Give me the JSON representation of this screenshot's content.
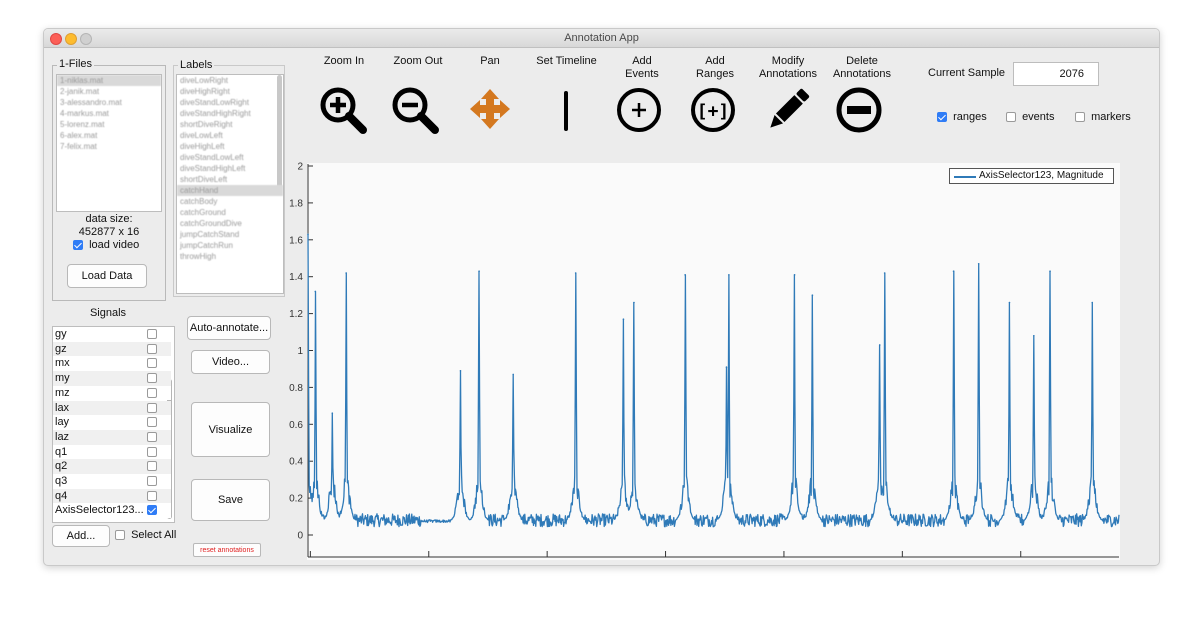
{
  "window": {
    "title": "Annotation App"
  },
  "files": {
    "title": "1-Files",
    "items": [
      "1-niklas.mat",
      "2-janik.mat",
      "3-alessandro.mat",
      "4-markus.mat",
      "5-lorenz.mat",
      "6-alex.mat",
      "7-felix.mat"
    ],
    "selected_index": 0,
    "data_size_label": "data size:",
    "data_size_value": "452877 x 16",
    "load_video_label": "load video",
    "load_video_checked": true,
    "load_button": "Load Data"
  },
  "labels": {
    "title": "Labels",
    "items": [
      "diveLowRight",
      "diveHighRight",
      "diveStandLowRight",
      "diveStandHighRight",
      "shortDiveRight",
      "diveLowLeft",
      "diveHighLeft",
      "diveStandLowLeft",
      "diveStandHighLeft",
      "shortDiveLeft",
      "catchHand",
      "catchBody",
      "catchGround",
      "catchGroundDive",
      "jumpCatchStand",
      "jumpCatchRun",
      "throwHigh"
    ],
    "selected_index": 10
  },
  "signals": {
    "title": "Signals",
    "items": [
      {
        "label": "gy",
        "checked": false
      },
      {
        "label": "gz",
        "checked": false
      },
      {
        "label": "mx",
        "checked": false
      },
      {
        "label": "my",
        "checked": false
      },
      {
        "label": "mz",
        "checked": false
      },
      {
        "label": "lax",
        "checked": false
      },
      {
        "label": "lay",
        "checked": false
      },
      {
        "label": "laz",
        "checked": false
      },
      {
        "label": "q1",
        "checked": false
      },
      {
        "label": "q2",
        "checked": false
      },
      {
        "label": "q3",
        "checked": false
      },
      {
        "label": "q4",
        "checked": false
      },
      {
        "label": "AxisSelector123...",
        "checked": true
      }
    ],
    "add_button": "Add...",
    "select_all_label": "Select All",
    "select_all_checked": false
  },
  "actions": {
    "auto_annotate": "Auto-annotate...",
    "video": "Video...",
    "visualize": "Visualize",
    "save": "Save",
    "reset": "reset annotations"
  },
  "toolbar": {
    "zoom_in": "Zoom In",
    "zoom_out": "Zoom Out",
    "pan": "Pan",
    "set_timeline": "Set Timeline",
    "add_events": "Add\nEvents",
    "add_ranges": "Add\nRanges",
    "modify": "Modify\nAnnotations",
    "delete": "Delete\nAnnotations"
  },
  "sample": {
    "label": "Current Sample",
    "value": "2076"
  },
  "visibility": {
    "ranges": {
      "label": "ranges",
      "checked": true
    },
    "events": {
      "label": "events",
      "checked": false
    },
    "markers": {
      "label": "markers",
      "checked": false
    }
  },
  "colors": {
    "line": "#2f7ab8",
    "pan_icon": "#d4781f",
    "checkbox": "#2f7cf6",
    "reset_text": "#e02020"
  },
  "chart_data": {
    "type": "line",
    "legend": [
      "AxisSelector123, Magnitude"
    ],
    "legend_position": "top-right",
    "ylim": [
      0,
      2
    ],
    "yticks": [
      0,
      0.2,
      0.4,
      0.6,
      0.8,
      1,
      1.2,
      1.4,
      1.6,
      1.8,
      2
    ],
    "ytick_labels": [
      "0",
      "0.2",
      "0.4",
      "0.6",
      "0.8",
      "1",
      "1.2",
      "1.4",
      "1.6",
      "1.8",
      "2"
    ],
    "x_tick_count": 7,
    "baseline": 0.08,
    "peaks": [
      {
        "x": 0.0,
        "y": 1.63
      },
      {
        "x": 0.009,
        "y": 1.32
      },
      {
        "x": 0.03,
        "y": 0.66
      },
      {
        "x": 0.047,
        "y": 1.42
      },
      {
        "x": 0.188,
        "y": 0.89
      },
      {
        "x": 0.211,
        "y": 1.43
      },
      {
        "x": 0.253,
        "y": 0.87
      },
      {
        "x": 0.33,
        "y": 1.42
      },
      {
        "x": 0.389,
        "y": 1.17
      },
      {
        "x": 0.402,
        "y": 1.26
      },
      {
        "x": 0.465,
        "y": 1.41
      },
      {
        "x": 0.516,
        "y": 0.91
      },
      {
        "x": 0.519,
        "y": 1.41
      },
      {
        "x": 0.6,
        "y": 1.41
      },
      {
        "x": 0.622,
        "y": 1.3
      },
      {
        "x": 0.705,
        "y": 1.03
      },
      {
        "x": 0.711,
        "y": 1.42
      },
      {
        "x": 0.796,
        "y": 1.43
      },
      {
        "x": 0.827,
        "y": 1.47
      },
      {
        "x": 0.865,
        "y": 1.26
      },
      {
        "x": 0.895,
        "y": 1.08
      },
      {
        "x": 0.915,
        "y": 1.43
      },
      {
        "x": 0.967,
        "y": 1.26
      }
    ]
  }
}
